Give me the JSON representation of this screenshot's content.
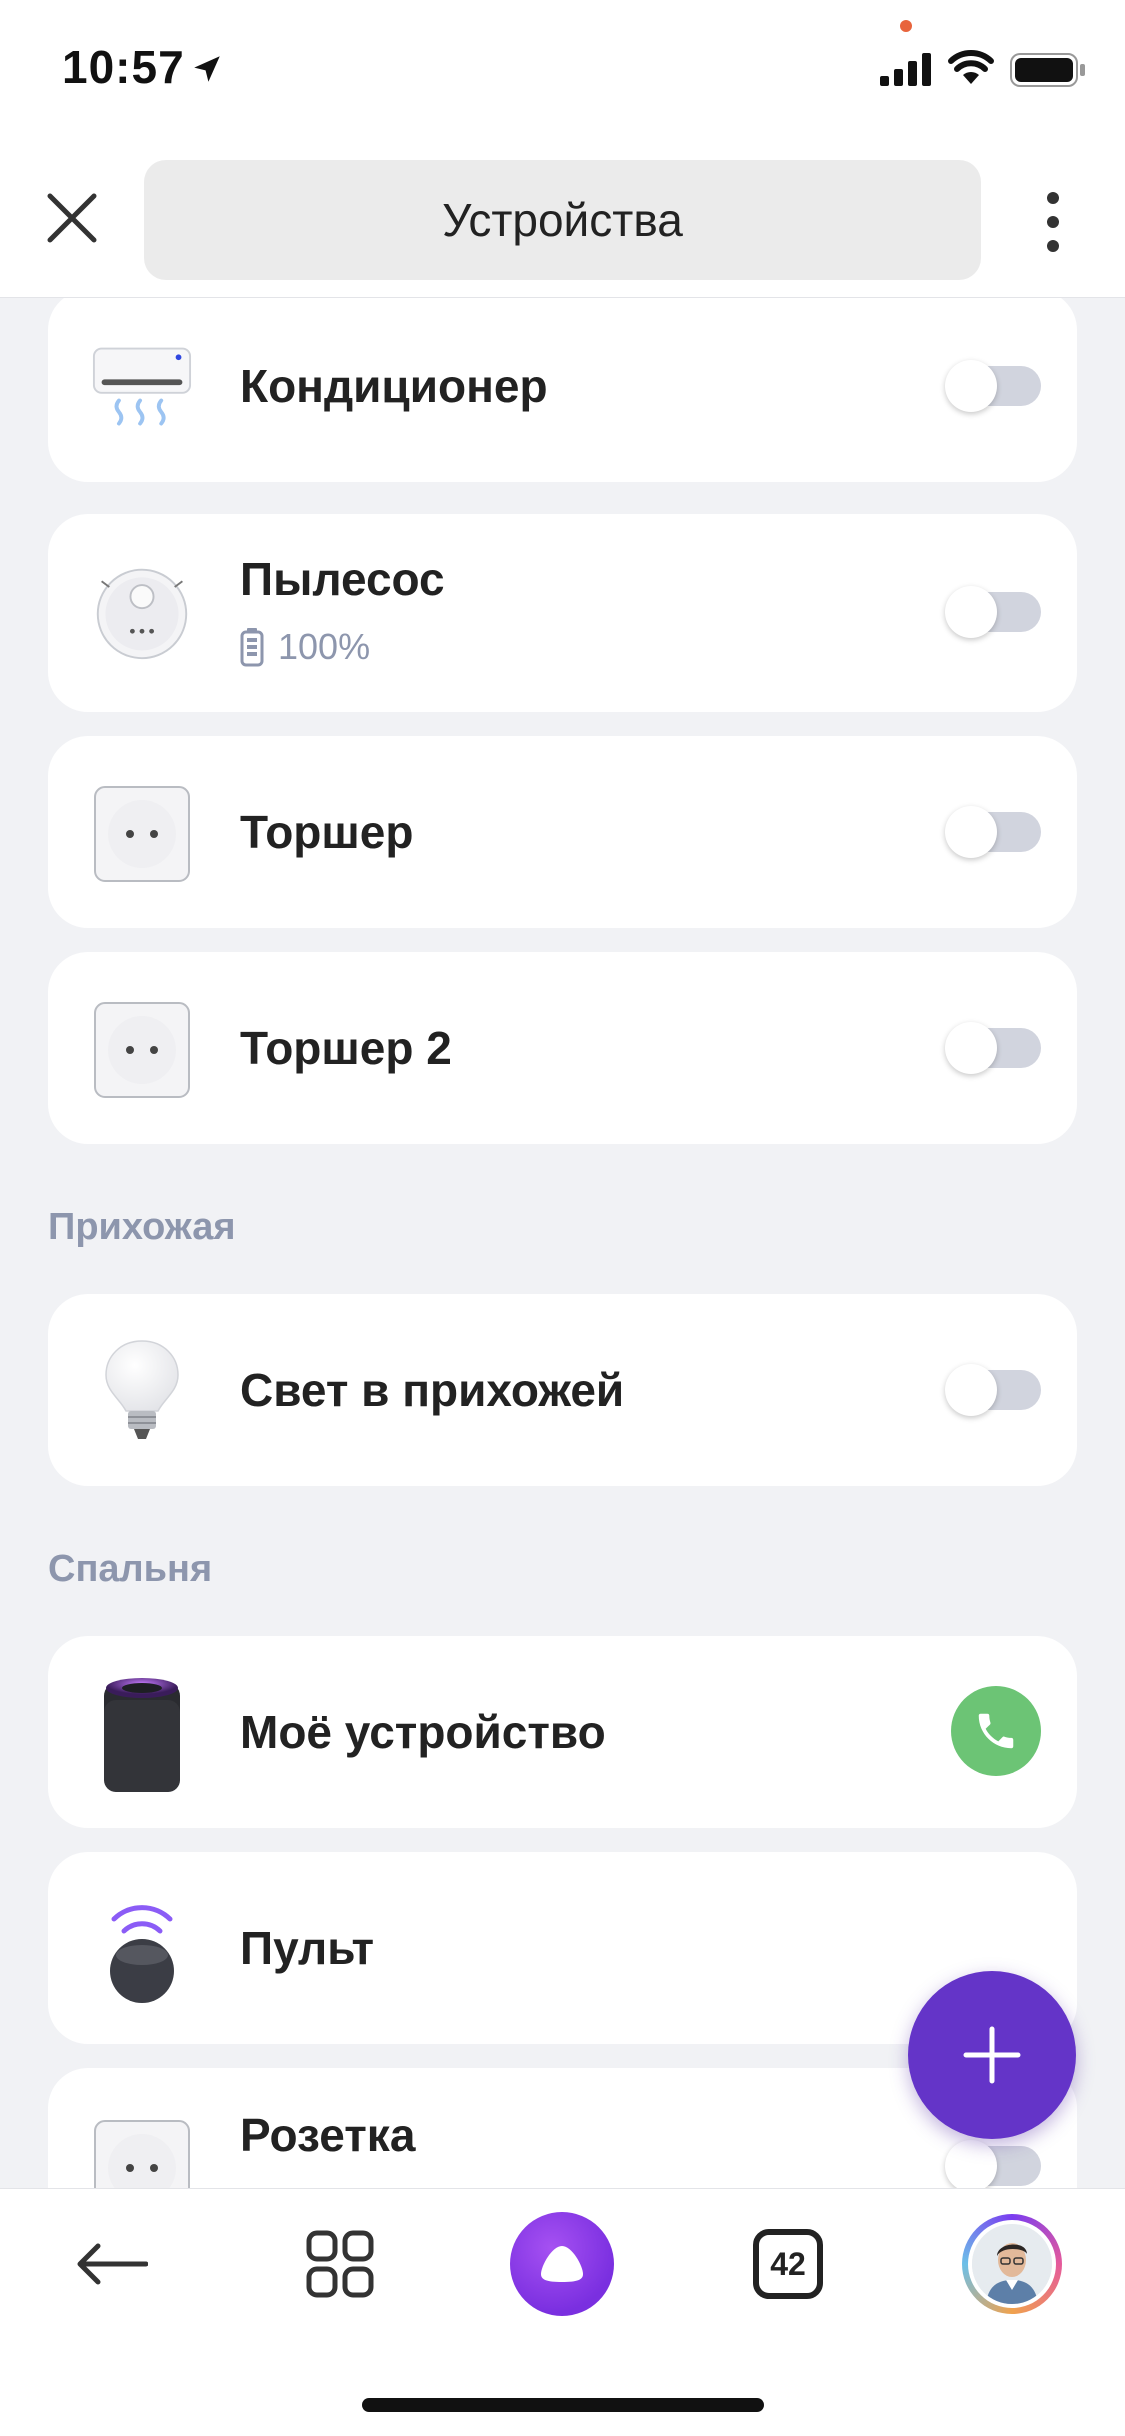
{
  "status_bar": {
    "time": "10:57",
    "icons": [
      "location-arrow-icon",
      "signal-icon",
      "wifi-icon",
      "battery-icon"
    ]
  },
  "header": {
    "title": "Устройства",
    "close_icon": "close-icon",
    "menu_icon": "more-vertical-icon"
  },
  "devices": [
    {
      "name": "Кондиционер",
      "icon": "air-conditioner-icon",
      "control": "toggle",
      "on": false
    },
    {
      "name": "Пылесос",
      "icon": "robot-vacuum-icon",
      "battery": "100%",
      "control": "toggle",
      "on": false
    },
    {
      "name": "Торшер",
      "icon": "socket-icon",
      "control": "toggle",
      "on": false
    },
    {
      "name": "Торшер 2",
      "icon": "socket-icon",
      "control": "toggle",
      "on": false
    }
  ],
  "sections": [
    {
      "title": "Прихожая",
      "devices": [
        {
          "name": "Свет в прихожей",
          "icon": "light-bulb-icon",
          "control": "toggle",
          "on": false
        }
      ]
    },
    {
      "title": "Спальня",
      "devices": [
        {
          "name": "Моё устройство",
          "icon": "smart-speaker-icon",
          "control": "call"
        },
        {
          "name": "Пульт",
          "icon": "remote-icon",
          "control": "none"
        },
        {
          "name": "Розетка",
          "icon": "socket-icon",
          "control": "toggle",
          "on": false
        }
      ]
    }
  ],
  "fab": {
    "icon": "plus-icon"
  },
  "bottom_nav": {
    "back_icon": "back-arrow-icon",
    "services_icon": "grid-icon",
    "alice_icon": "alice-icon",
    "tabs_count": "42",
    "avatar_icon": "avatar"
  },
  "colors": {
    "accent": "#6434c8",
    "call_green": "#6cc475",
    "section_text": "#8d96ad",
    "background": "#f1f2f5"
  }
}
